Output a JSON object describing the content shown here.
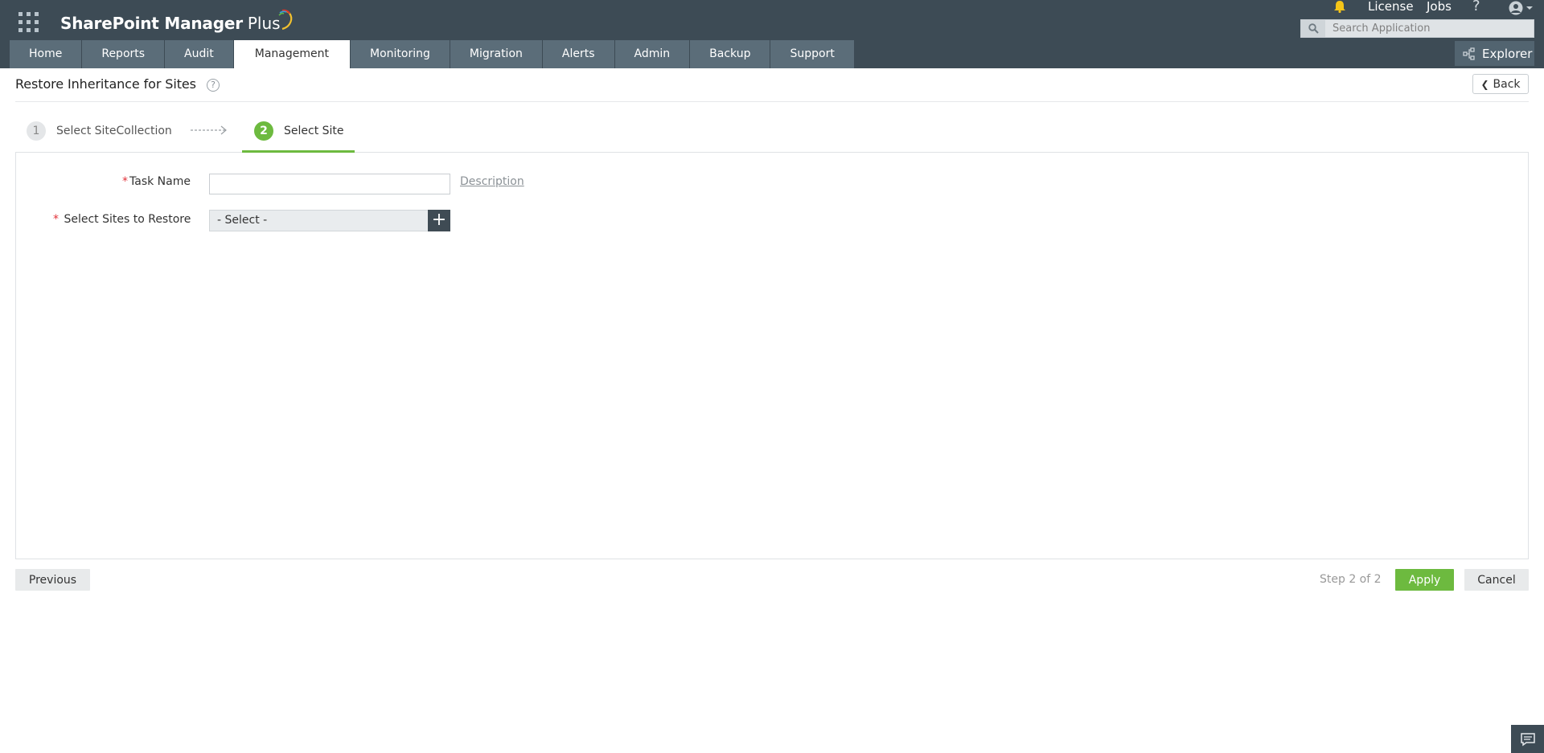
{
  "app": {
    "brand_name": "SharePoint Manager",
    "brand_plus": "Plus",
    "colors": {
      "header": "#3d4b55",
      "tab": "#5b6d79",
      "accent_green": "#6dba3f",
      "required": "#e2323a"
    }
  },
  "header": {
    "license_label": "License",
    "jobs_label": "Jobs",
    "help_label": "?",
    "search_placeholder": "Search Application",
    "explorer_label": "Explorer"
  },
  "tabs": [
    {
      "label": "Home"
    },
    {
      "label": "Reports"
    },
    {
      "label": "Audit"
    },
    {
      "label": "Management",
      "active": true
    },
    {
      "label": "Monitoring"
    },
    {
      "label": "Migration"
    },
    {
      "label": "Alerts"
    },
    {
      "label": "Admin"
    },
    {
      "label": "Backup"
    },
    {
      "label": "Support"
    }
  ],
  "page": {
    "title": "Restore Inheritance for Sites",
    "help_glyph": "?",
    "back_label": "Back"
  },
  "wizard": {
    "steps": [
      {
        "number": "1",
        "label": "Select SiteCollection"
      },
      {
        "number": "2",
        "label": "Select Site"
      }
    ],
    "current_step": 2
  },
  "form": {
    "required_mark": "*",
    "task_name_label": "Task Name",
    "task_name_value": "",
    "description_link": "Description",
    "sites_label": "Select Sites to Restore",
    "sites_selected": "- Select -",
    "add_glyph": "+"
  },
  "footer": {
    "previous_label": "Previous",
    "step_count": "Step 2 of 2",
    "apply_label": "Apply",
    "cancel_label": "Cancel"
  }
}
